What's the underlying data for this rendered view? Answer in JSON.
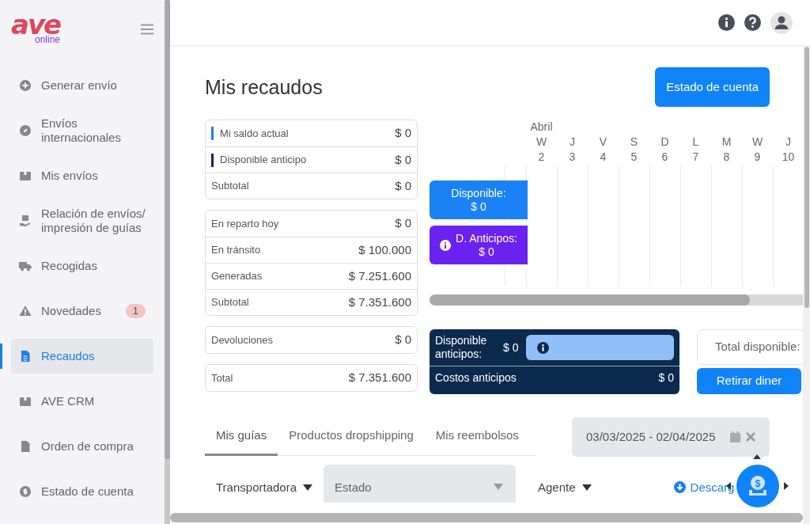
{
  "logo": {
    "text": "ave",
    "sub": "online"
  },
  "sidebar": {
    "items": [
      {
        "label": "Generar envío",
        "selected": false
      },
      {
        "label": "Envíos internacionales",
        "selected": false
      },
      {
        "label": "Mis envíos",
        "selected": false
      },
      {
        "label": "Relación de envíos/ impresión de guías",
        "selected": false
      },
      {
        "label": "Recogidas",
        "selected": false
      },
      {
        "label": "Novedades",
        "selected": false,
        "badge": "1"
      },
      {
        "label": "Recaudos",
        "selected": true
      },
      {
        "label": "AVE CRM",
        "selected": false
      },
      {
        "label": "Orden de compra",
        "selected": false
      },
      {
        "label": "Estado de cuenta",
        "selected": false
      }
    ]
  },
  "title": "Mis recaudos",
  "account_button": "Estado de cuenta",
  "summary_groups": [
    [
      {
        "label": "Mi saldo actual",
        "value": "$ 0",
        "color": "#1a82f5"
      },
      {
        "label": "Disponible anticipo",
        "value": "$ 0",
        "color": "#0c2a4d"
      },
      {
        "label": "Subtotal",
        "value": "$ 0"
      }
    ],
    [
      {
        "label": "En reparto hoy",
        "value": "$ 0"
      },
      {
        "label": "En tránsito",
        "value": "$ 100.000"
      },
      {
        "label": "Generadas",
        "value": "$ 7.251.600"
      },
      {
        "label": "Subtotal",
        "value": "$ 7.351.600"
      }
    ],
    [
      {
        "label": "Devoluciones",
        "value": "$ 0"
      }
    ],
    [
      {
        "label": "Total",
        "value": "$ 7.351.600"
      }
    ]
  ],
  "calendar": {
    "month": "Abril",
    "days": [
      {
        "weekday": "W",
        "day": "2"
      },
      {
        "weekday": "J",
        "day": "3"
      },
      {
        "weekday": "V",
        "day": "4"
      },
      {
        "weekday": "S",
        "day": "5"
      },
      {
        "weekday": "D",
        "day": "6"
      },
      {
        "weekday": "L",
        "day": "7"
      },
      {
        "weekday": "M",
        "day": "8"
      },
      {
        "weekday": "W",
        "day": "9"
      },
      {
        "weekday": "J",
        "day": "10"
      }
    ],
    "bars": [
      {
        "label": "Disponible:",
        "value": "$ 0",
        "color": "#1a82f5",
        "info": false
      },
      {
        "label": "D. Anticipos:",
        "value": "$ 0",
        "color": "#6a22f0",
        "info": true
      }
    ]
  },
  "advances": {
    "label": "Disponible anticipos:",
    "value": "$ 0",
    "costs_label": "Costos anticipos",
    "costs_value": "$ 0"
  },
  "total_label": "Total disponible:",
  "withdraw_button": "Retirar diner",
  "tabs": [
    {
      "label": "Mis guías",
      "selected": true
    },
    {
      "label": "Productos dropshipping",
      "selected": false
    },
    {
      "label": "Mis reembolsos",
      "selected": false
    }
  ],
  "date_range": {
    "value": "03/03/2025 - 02/04/2025"
  },
  "fab_symbol": "$",
  "filters": {
    "carrier": "Transportadora",
    "status": "Estado",
    "agent": "Agente",
    "download": "Descarg"
  }
}
